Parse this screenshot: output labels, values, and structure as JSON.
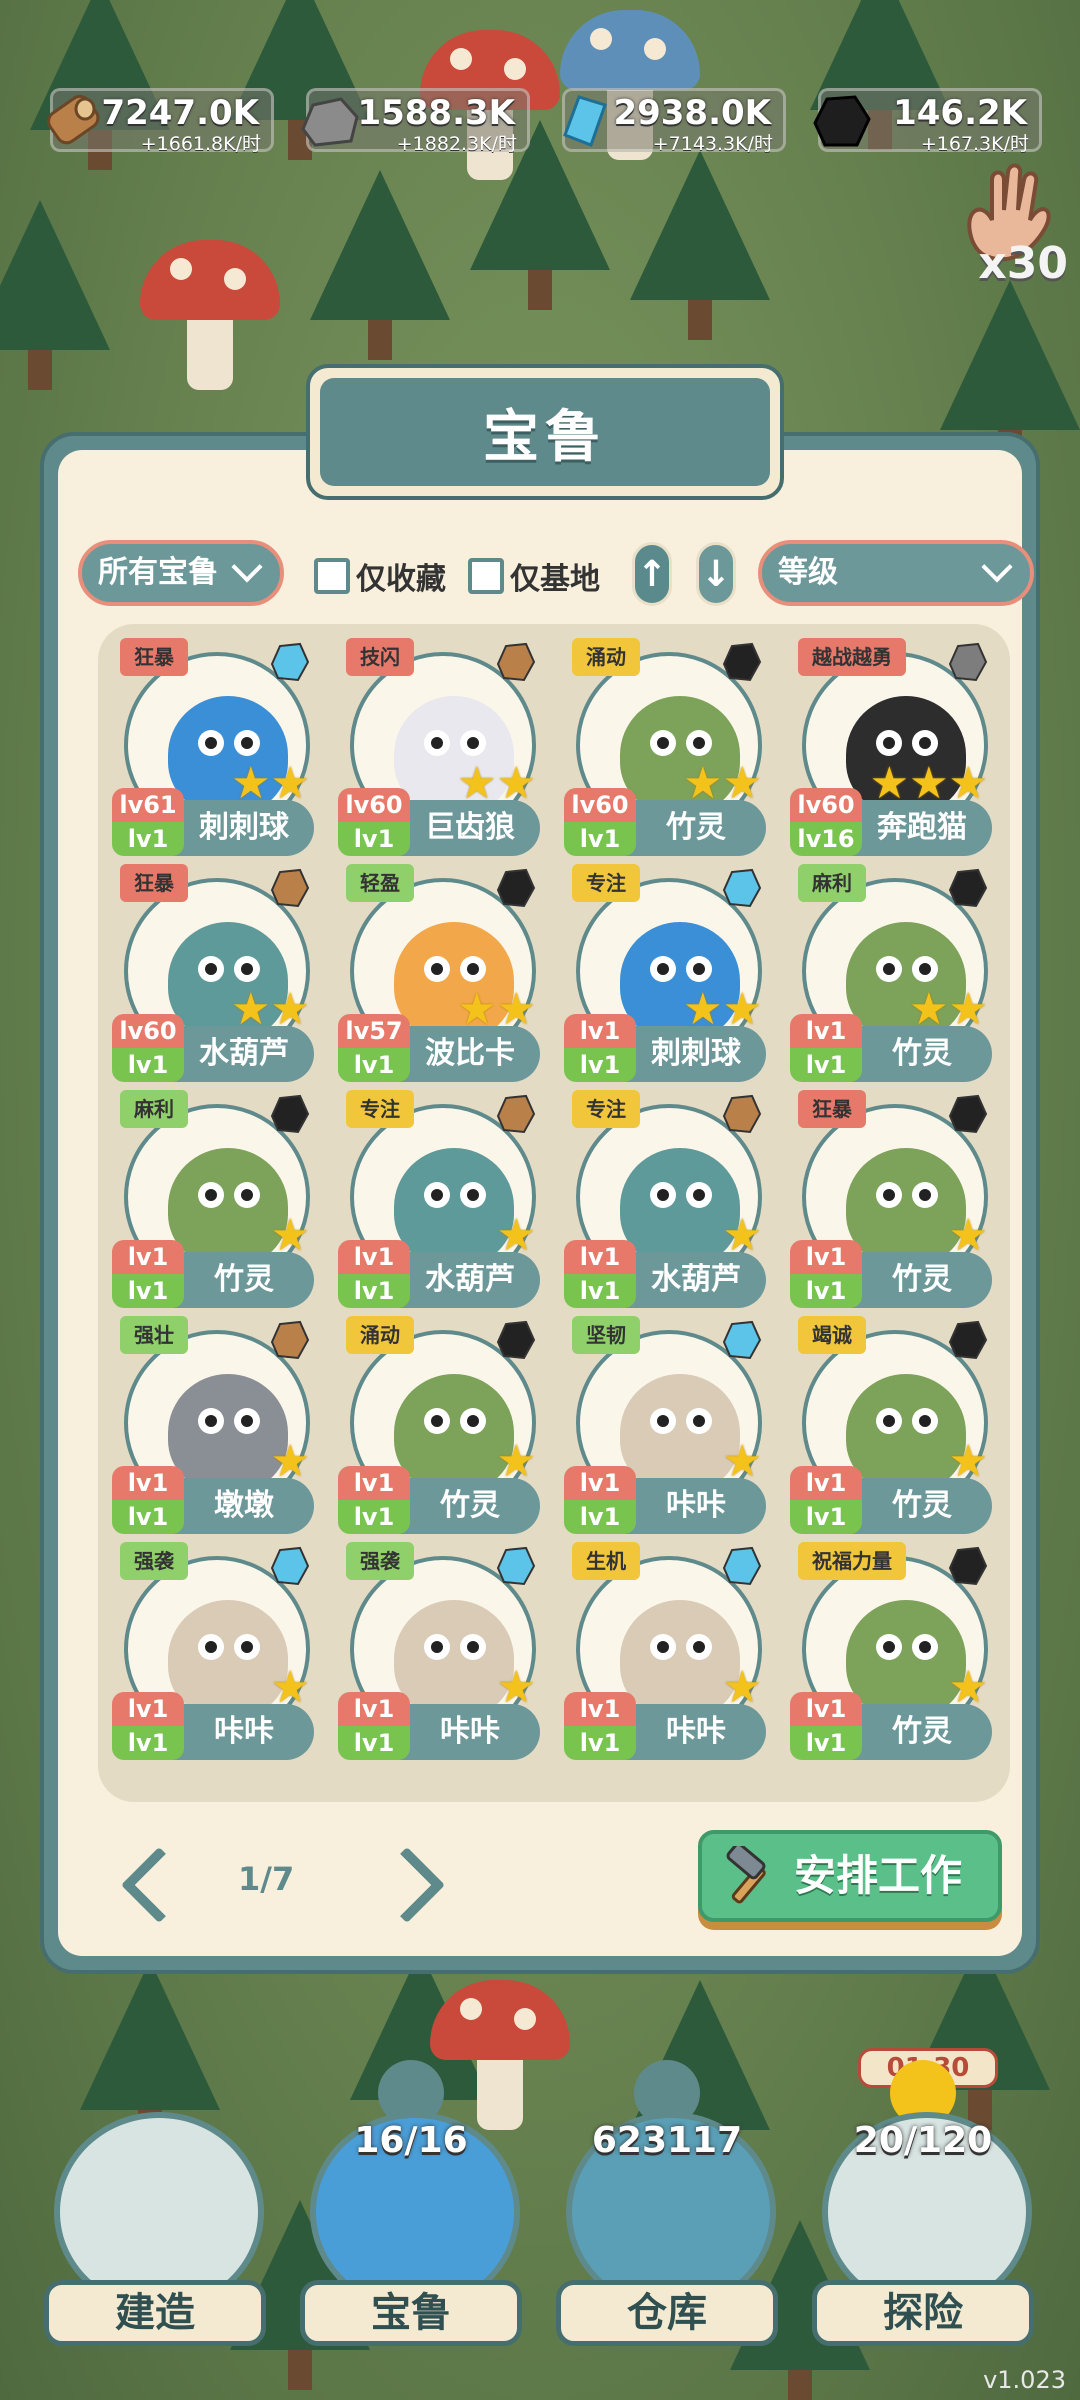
{
  "resources": [
    {
      "id": "wood",
      "amount": "7247.0K",
      "rate": "+1661.8K/时",
      "color": "#b98049"
    },
    {
      "id": "stone",
      "amount": "1588.3K",
      "rate": "+1882.3K/时",
      "color": "#7d7d7d"
    },
    {
      "id": "crystal",
      "amount": "2938.0K",
      "rate": "+7143.3K/时",
      "color": "#5bc4e8"
    },
    {
      "id": "coal",
      "amount": "146.2K",
      "rate": "+167.3K/时",
      "color": "#222222"
    }
  ],
  "hand_count": "x30",
  "panel": {
    "title": "宝鲁",
    "filter_dropdown": "所有宝鲁",
    "favorites_only": "仅收藏",
    "base_only": "仅基地",
    "sort_up": "↑",
    "sort_down": "↓",
    "sort_field": "等级"
  },
  "pals": [
    {
      "trait": "狂暴",
      "trait_color": "#e7796a",
      "name": "刺刺球",
      "lv": "lv61",
      "lv2": "lv1",
      "res": "crystal",
      "stars": "★★",
      "body": "#3a8fd6"
    },
    {
      "trait": "技闪",
      "trait_color": "#e7796a",
      "name": "巨齿狼",
      "lv": "lv60",
      "lv2": "lv1",
      "res": "wood",
      "stars": "★★",
      "body": "#e8e8ee"
    },
    {
      "trait": "涌动",
      "trait_color": "#f2c63a",
      "name": "竹灵",
      "lv": "lv60",
      "lv2": "lv1",
      "res": "coal",
      "stars": "★★",
      "body": "#7da25a"
    },
    {
      "trait": "越战越勇",
      "trait_color": "#e7796a",
      "name": "奔跑猫",
      "lv": "lv60",
      "lv2": "lv16",
      "res": "stone",
      "stars": "★★★",
      "body": "#2d2d2d"
    },
    {
      "trait": "狂暴",
      "trait_color": "#e7796a",
      "name": "水葫芦",
      "lv": "lv60",
      "lv2": "lv1",
      "res": "wood",
      "stars": "★★",
      "body": "#5f9a9a"
    },
    {
      "trait": "轻盈",
      "trait_color": "#8fd06a",
      "name": "波比卡",
      "lv": "lv57",
      "lv2": "lv1",
      "res": "coal",
      "stars": "★★",
      "body": "#f2a84a"
    },
    {
      "trait": "专注",
      "trait_color": "#f2c63a",
      "name": "刺刺球",
      "lv": "lv1",
      "lv2": "lv1",
      "res": "crystal",
      "stars": "★★",
      "body": "#3a8fd6"
    },
    {
      "trait": "麻利",
      "trait_color": "#8fd06a",
      "name": "竹灵",
      "lv": "lv1",
      "lv2": "lv1",
      "res": "coal",
      "stars": "★★",
      "body": "#7da25a"
    },
    {
      "trait": "麻利",
      "trait_color": "#8fd06a",
      "name": "竹灵",
      "lv": "lv1",
      "lv2": "lv1",
      "res": "coal",
      "stars": "★",
      "body": "#7da25a"
    },
    {
      "trait": "专注",
      "trait_color": "#f2c63a",
      "name": "水葫芦",
      "lv": "lv1",
      "lv2": "lv1",
      "res": "wood",
      "stars": "★",
      "body": "#5f9a9a"
    },
    {
      "trait": "专注",
      "trait_color": "#f2c63a",
      "name": "水葫芦",
      "lv": "lv1",
      "lv2": "lv1",
      "res": "wood",
      "stars": "★",
      "body": "#5f9a9a"
    },
    {
      "trait": "狂暴",
      "trait_color": "#e7796a",
      "name": "竹灵",
      "lv": "lv1",
      "lv2": "lv1",
      "res": "coal",
      "stars": "★",
      "body": "#7da25a"
    },
    {
      "trait": "强壮",
      "trait_color": "#8fd06a",
      "name": "墩墩",
      "lv": "lv1",
      "lv2": "lv1",
      "res": "wood",
      "stars": "★",
      "body": "#8a8f96"
    },
    {
      "trait": "涌动",
      "trait_color": "#f2c63a",
      "name": "竹灵",
      "lv": "lv1",
      "lv2": "lv1",
      "res": "coal",
      "stars": "★",
      "body": "#7da25a"
    },
    {
      "trait": "坚韧",
      "trait_color": "#8fd06a",
      "name": "咔咔",
      "lv": "lv1",
      "lv2": "lv1",
      "res": "crystal",
      "stars": "★",
      "body": "#d9cbb6"
    },
    {
      "trait": "竭诚",
      "trait_color": "#f2c63a",
      "name": "竹灵",
      "lv": "lv1",
      "lv2": "lv1",
      "res": "coal",
      "stars": "★",
      "body": "#7da25a"
    },
    {
      "trait": "强袭",
      "trait_color": "#8fd06a",
      "name": "咔咔",
      "lv": "lv1",
      "lv2": "lv1",
      "res": "crystal",
      "stars": "★",
      "body": "#d9cbb6"
    },
    {
      "trait": "强袭",
      "trait_color": "#8fd06a",
      "name": "咔咔",
      "lv": "lv1",
      "lv2": "lv1",
      "res": "crystal",
      "stars": "★",
      "body": "#d9cbb6"
    },
    {
      "trait": "生机",
      "trait_color": "#f2c63a",
      "name": "咔咔",
      "lv": "lv1",
      "lv2": "lv1",
      "res": "crystal",
      "stars": "★",
      "body": "#d9cbb6"
    },
    {
      "trait": "祝福力量",
      "trait_color": "#f2c63a",
      "name": "竹灵",
      "lv": "lv1",
      "lv2": "lv1",
      "res": "coal",
      "stars": "★",
      "body": "#7da25a"
    }
  ],
  "pager": {
    "page": "1/7"
  },
  "work_button": "安排工作",
  "nav": [
    {
      "label": "建造",
      "count": ""
    },
    {
      "label": "宝鲁",
      "count": "16/16"
    },
    {
      "label": "仓库",
      "count": "623117"
    },
    {
      "label": "探险",
      "count": "20/120",
      "timer": "01:30"
    }
  ],
  "version": "v1.023"
}
